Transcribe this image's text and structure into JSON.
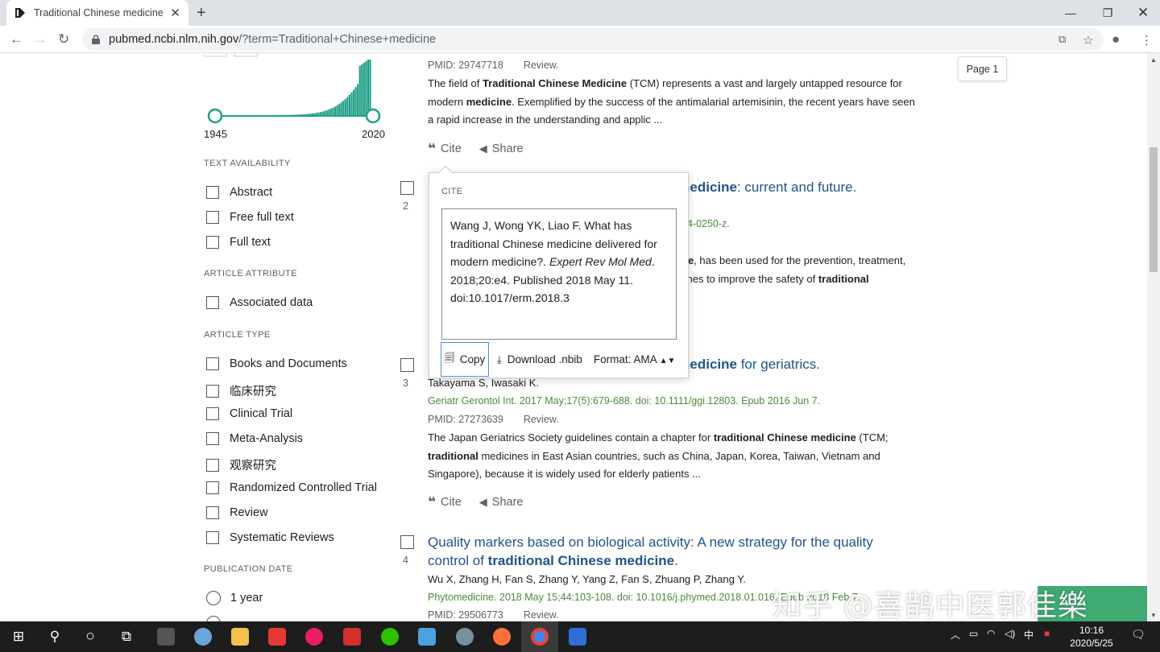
{
  "browser": {
    "tab_title": "Traditional Chinese medicine -",
    "url_domain": "pubmed.ncbi.nlm.nih.gov",
    "url_path": "/?term=Traditional+Chinese+medicine"
  },
  "sidebar": {
    "histogram": {
      "start_year": "1945",
      "end_year": "2020"
    },
    "text_availability": {
      "title": "TEXT AVAILABILITY",
      "items": [
        "Abstract",
        "Free full text",
        "Full text"
      ]
    },
    "article_attribute": {
      "title": "ARTICLE ATTRIBUTE",
      "items": [
        "Associated data"
      ]
    },
    "article_type": {
      "title": "ARTICLE TYPE",
      "items": [
        "Books and Documents",
        "临床研究",
        "Clinical Trial",
        "Meta-Analysis",
        "观察研究",
        "Randomized Controlled Trial",
        "Review",
        "Systematic Reviews"
      ]
    },
    "publication_date": {
      "title": "PUBLICATION DATE",
      "items": [
        "1 year"
      ]
    }
  },
  "results": {
    "r1": {
      "pmid": "PMID: 29747718",
      "type": "Review.",
      "snippet_parts": [
        "The field of ",
        "Traditional Chinese Medicine",
        " (TCM) represents a vast and largely untapped resource for modern ",
        "medicine",
        ". Exemplified by the success of the antimalarial artemisinin, the recent years have seen a rapid increase in the understanding and applic ..."
      ]
    },
    "r2": {
      "number": "2",
      "title_bold": "nedicine",
      "title_rest": ": current and future.",
      "doi_tail": "14-0250-z.",
      "snippet_l1_bold": "ne",
      "snippet_l1": ", has been used for the prevention, treatment,",
      "snippet_l2": "ches to improve the safety of ",
      "snippet_l2_bold": "traditional"
    },
    "r3": {
      "number": "3",
      "title_bold": "nedicine",
      "title_rest": " for geriatrics.",
      "authors": "Takayama S, Iwasaki K.",
      "journal": "Geriatr Gerontol Int. 2017 May;17(5):679-688. doi: 10.1111/ggi.12803. Epub 2016 Jun 7.",
      "pmid": "PMID: 27273639",
      "type": "Review.",
      "snippet_parts": [
        "The Japan Geriatrics Society guidelines contain a chapter for ",
        "traditional Chinese medicine",
        " (TCM; ",
        "traditional",
        " medicines in East Asian countries, such as China, Japan, Korea, Taiwan, Vietnam and Singapore), because it is widely used for elderly patients ..."
      ]
    },
    "r4": {
      "number": "4",
      "title_a": "Quality markers based on biological activity: A new strategy for the quality control of ",
      "title_bold": "traditional Chinese medicine",
      "title_end": ".",
      "authors": "Wu X, Zhang H, Fan S, Zhang Y, Yang Z, Fan S, Zhuang P, Zhang Y.",
      "journal": "Phytomedicine. 2018 May 15;44:103-108. doi: 10.1016/j.phymed.2018.01.016. Epub 2018 Feb 7.",
      "pmid": "PMID: 29506773",
      "type": "Review."
    },
    "actions": {
      "cite": "Cite",
      "share": "Share"
    },
    "page_label": "Page 1"
  },
  "cite_popup": {
    "label": "CITE",
    "citation_a": "Wang J, Wong YK, Liao F. What has traditional Chinese medicine delivered for modern medicine?. ",
    "citation_journal": "Expert Rev Mol Med",
    "citation_b": ". 2018;20:e4. Published 2018 May 11. doi:10.1017/erm.2018.3",
    "copy": "Copy",
    "download": "Download .nbib",
    "format": "Format: AMA"
  },
  "watermark": "知乎 @喜鹊中医郭佳樂",
  "taskbar": {
    "time": "10:16",
    "date": "2020/5/25",
    "ime": "中"
  },
  "colors": {
    "link": "#20558a",
    "journal": "#4b8b3b",
    "histogram": "#20a088"
  }
}
